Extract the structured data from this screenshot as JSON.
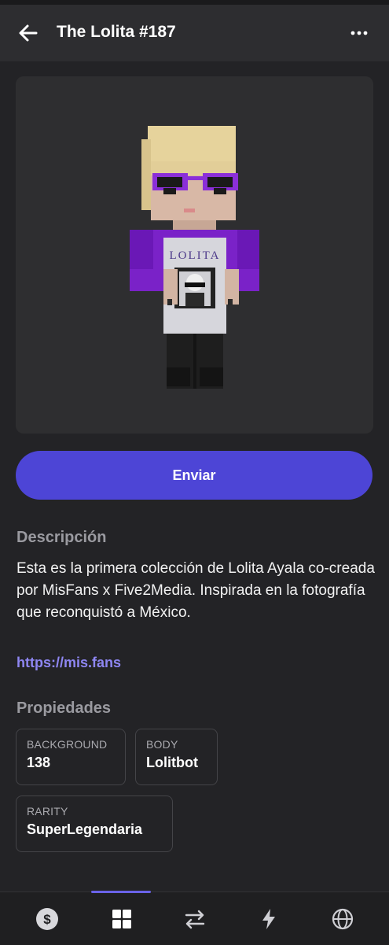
{
  "header": {
    "title": "The Lolita #187",
    "back_icon": "arrow-left-icon",
    "more_icon": "more-horizontal-icon"
  },
  "artwork": {
    "shirt_text": "LOLITA"
  },
  "actions": {
    "send_label": "Enviar"
  },
  "description": {
    "heading": "Descripción",
    "text": "Esta es la primera colección de Lolita Ayala co-creada por MisFans x Five2Media. Inspirada en la fotografía que reconquistó a México.",
    "link": "https://mis.fans"
  },
  "properties": {
    "heading": "Propiedades",
    "items": [
      {
        "key": "BACKGROUND",
        "value": "138"
      },
      {
        "key": "BODY",
        "value": "Lolitbot"
      },
      {
        "key": "RARITY",
        "value": "SuperLegendaria"
      }
    ]
  },
  "bottom_nav": {
    "items": [
      {
        "icon": "dollar-coin-icon",
        "active": false
      },
      {
        "icon": "grid-icon",
        "active": true
      },
      {
        "icon": "transfer-arrows-icon",
        "active": false
      },
      {
        "icon": "lightning-icon",
        "active": false
      },
      {
        "icon": "globe-icon",
        "active": false
      }
    ]
  },
  "colors": {
    "accent": "#4d45d6",
    "link": "#8e86f2",
    "background": "#232326"
  }
}
